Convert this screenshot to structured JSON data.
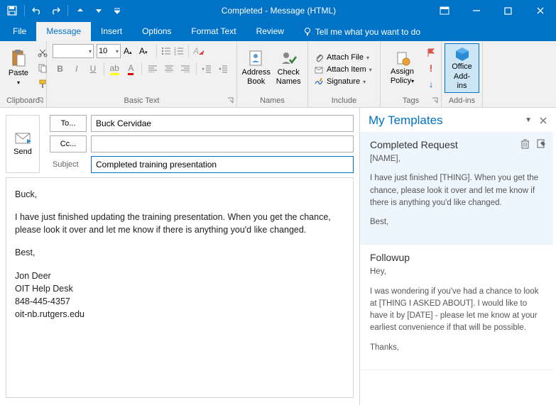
{
  "window": {
    "title": "Completed  -  Message (HTML)"
  },
  "tabs": {
    "file": "File",
    "message": "Message",
    "insert": "Insert",
    "options": "Options",
    "formatText": "Format Text",
    "review": "Review",
    "tellMe": "Tell me what you want to do"
  },
  "ribbon": {
    "paste": "Paste",
    "clipboard": "Clipboard",
    "fontName": "",
    "fontSize": "10",
    "basicText": "Basic Text",
    "addressBook": "Address Book",
    "checkNames": "Check Names",
    "names": "Names",
    "attachFile": "Attach File",
    "attachItem": "Attach Item",
    "signature": "Signature",
    "include": "Include",
    "assignPolicy": "Assign Policy",
    "tags": "Tags",
    "officeAddins": "Office Add-ins",
    "addins": "Add-ins"
  },
  "compose": {
    "send": "Send",
    "toLabel": "To...",
    "ccLabel": "Cc...",
    "subjectLabel": "Subject",
    "to": "Buck Cervidae",
    "cc": "",
    "subject": "Completed training presentation",
    "body": {
      "greeting": "Buck,",
      "p1": "I have just finished updating the training presentation. When you get the chance, please look it over and let me know if there is anything you'd like changed.",
      "closing": "Best,",
      "sig1": "Jon Deer",
      "sig2": "OIT Help Desk",
      "sig3": "848-445-4357",
      "sig4": "oit-nb.rutgers.edu"
    }
  },
  "pane": {
    "title": "My Templates",
    "templates": [
      {
        "title": "Completed Request",
        "greeting": "[NAME],",
        "body": "I have just finished [THING]. When you get the chance, please look it over and let me know if there is anything you'd like changed.",
        "closing": "Best,"
      },
      {
        "title": "Followup",
        "greeting": "Hey,",
        "body": "I was wondering if you've had a chance to look at [THING I ASKED ABOUT]. I would like to have it by [DATE] - please let me know at your earliest convenience if that will be possible.",
        "closing": "Thanks,"
      }
    ]
  }
}
